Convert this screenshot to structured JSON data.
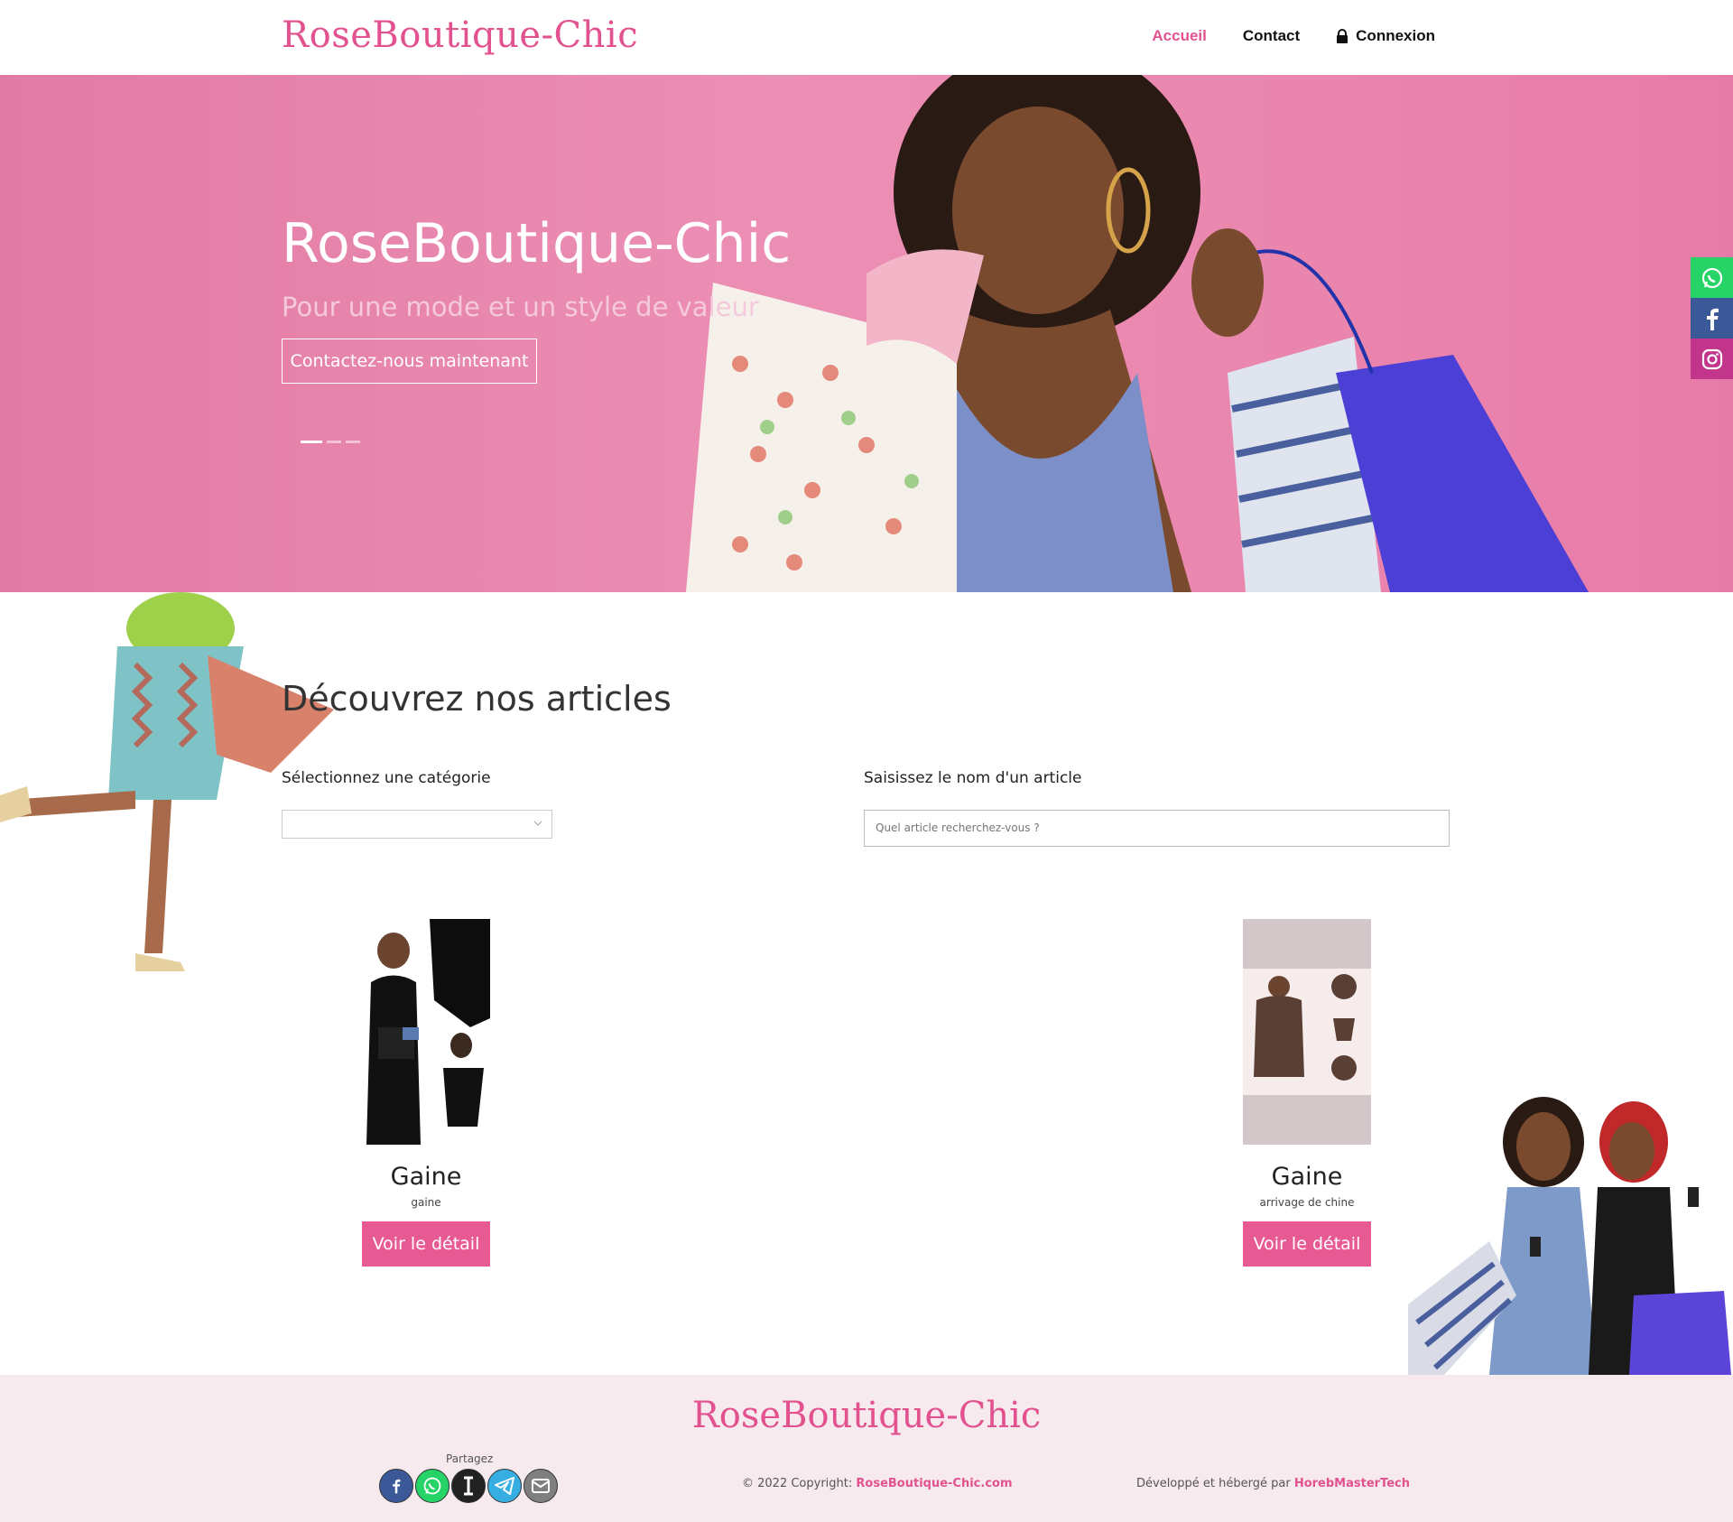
{
  "header": {
    "logo": "RoseBoutique-Chic",
    "nav": {
      "home": "Accueil",
      "contact": "Contact",
      "login": "Connexion"
    }
  },
  "hero": {
    "title": "RoseBoutique-Chic",
    "subtitle": "Pour une mode et un style de valeur",
    "cta": "Contactez-nous maintenant",
    "slides_total": 3,
    "active_slide": 1
  },
  "social": [
    "whatsapp-icon",
    "facebook-icon",
    "instagram-icon"
  ],
  "catalog": {
    "title": "Découvrez nos articles",
    "category_label": "Sélectionnez une catégorie",
    "search_label": "Saisissez le nom d'un article",
    "search_placeholder": "Quel article recherchez-vous ?",
    "products": [
      {
        "name": "Gaine",
        "desc": "gaine",
        "button": "Voir le détail"
      },
      {
        "name": "Gaine",
        "desc": "arrivage de chine",
        "button": "Voir le détail"
      }
    ]
  },
  "footer": {
    "logo": "RoseBoutique-Chic",
    "share_label": "Partagez",
    "copyright_prefix": "© 2022 Copyright:",
    "copyright_site": "RoseBoutique-Chic.com",
    "dev_prefix": "Développé et hébergé par",
    "dev_name": "HorebMasterTech"
  },
  "colors": {
    "brand": "#e2528f",
    "button": "#e85a93",
    "footer_bg": "#f6eaee"
  }
}
